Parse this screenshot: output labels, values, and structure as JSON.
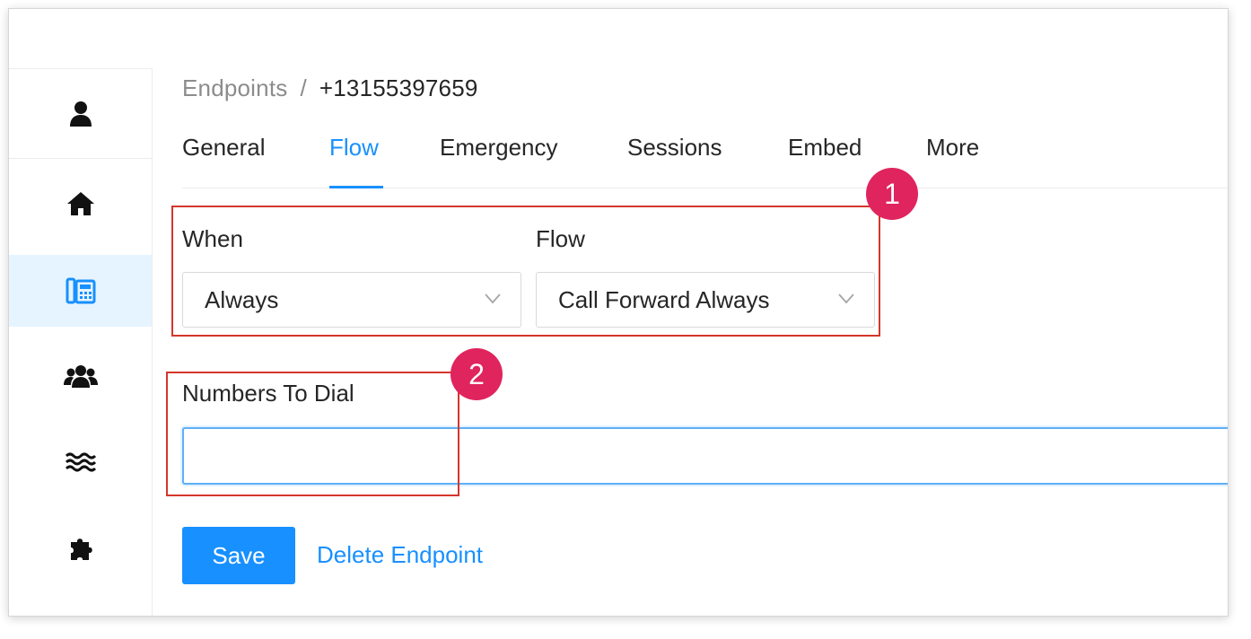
{
  "breadcrumb": {
    "root": "Endpoints",
    "separator": "/",
    "current": "+13155397659"
  },
  "sidebar": {
    "items": [
      {
        "icon": "user-icon"
      },
      {
        "icon": "home-icon"
      },
      {
        "icon": "phone-system-icon",
        "active": true
      },
      {
        "icon": "users-icon"
      },
      {
        "icon": "waves-icon"
      },
      {
        "icon": "puzzle-icon"
      }
    ]
  },
  "tabs": [
    {
      "label": "General"
    },
    {
      "label": "Flow",
      "active": true
    },
    {
      "label": "Emergency"
    },
    {
      "label": "Sessions"
    },
    {
      "label": "Embed"
    },
    {
      "label": "More"
    }
  ],
  "form": {
    "when": {
      "label": "When",
      "value": "Always"
    },
    "flow": {
      "label": "Flow",
      "value": "Call Forward Always"
    },
    "numbers": {
      "label": "Numbers To Dial",
      "value": ""
    }
  },
  "actions": {
    "save_label": "Save",
    "delete_label": "Delete Endpoint"
  },
  "annotations": [
    {
      "number": "1"
    },
    {
      "number": "2"
    }
  ],
  "colors": {
    "accent": "#1890ff",
    "active_bg": "#e6f4ff",
    "annotation_box": "#d4362b",
    "annotation_badge": "#e0245e"
  }
}
